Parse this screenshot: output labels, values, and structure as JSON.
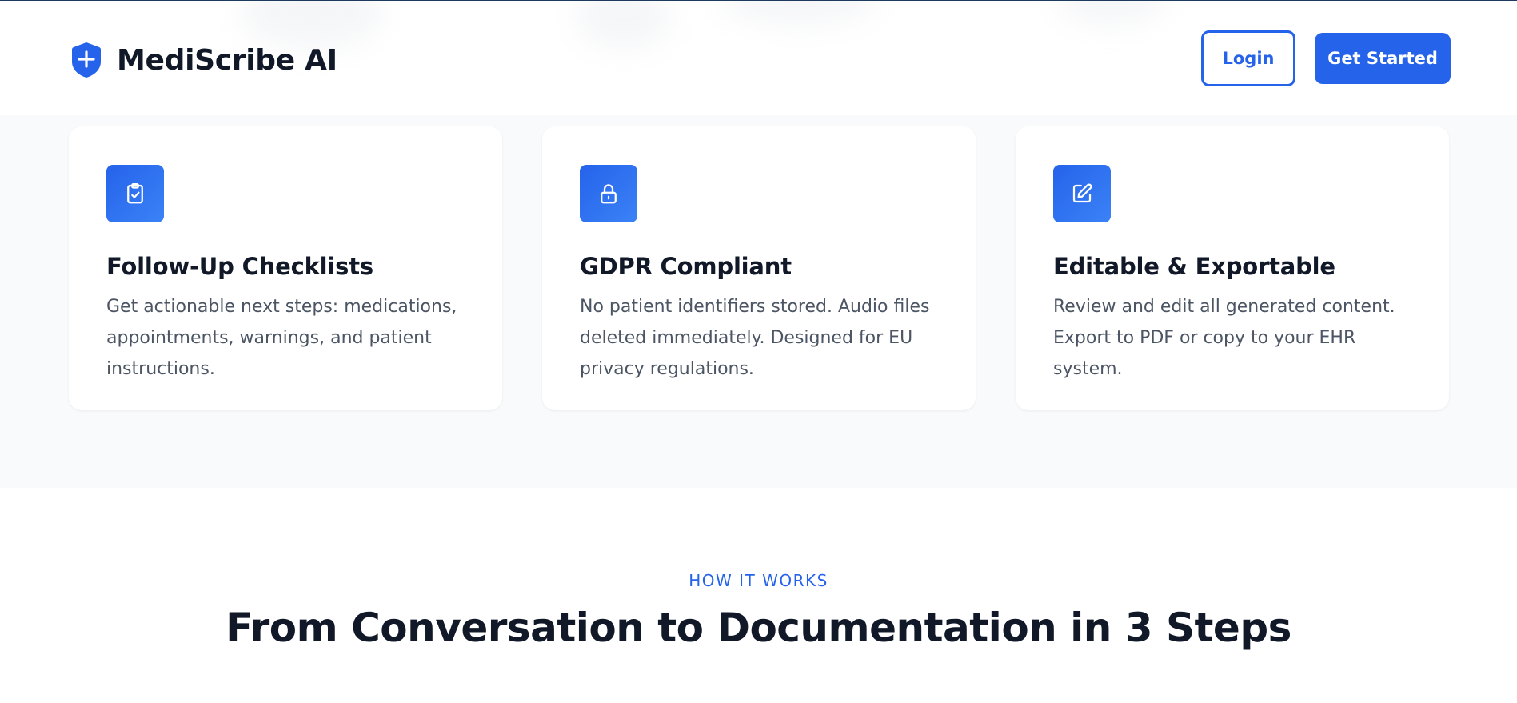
{
  "brand": {
    "name": "MediScribe AI",
    "logo_icon": "shield-plus-icon",
    "accent_color": "#2563eb"
  },
  "nav": {
    "login_label": "Login",
    "get_started_label": "Get Started"
  },
  "features": [
    {
      "icon": "clipboard-check-icon",
      "title": "Follow-Up Checklists",
      "description": "Get actionable next steps: medications, appointments, warnings, and patient instructions."
    },
    {
      "icon": "lock-icon",
      "title": "GDPR Compliant",
      "description": "No patient identifiers stored. Audio files deleted immediately. Designed for EU privacy regulations."
    },
    {
      "icon": "edit-icon",
      "title": "Editable & Exportable",
      "description": "Review and edit all generated content. Export to PDF or copy to your EHR system."
    }
  ],
  "how_it_works": {
    "eyebrow": "HOW IT WORKS",
    "title": "From Conversation to Documentation in 3 Steps"
  }
}
